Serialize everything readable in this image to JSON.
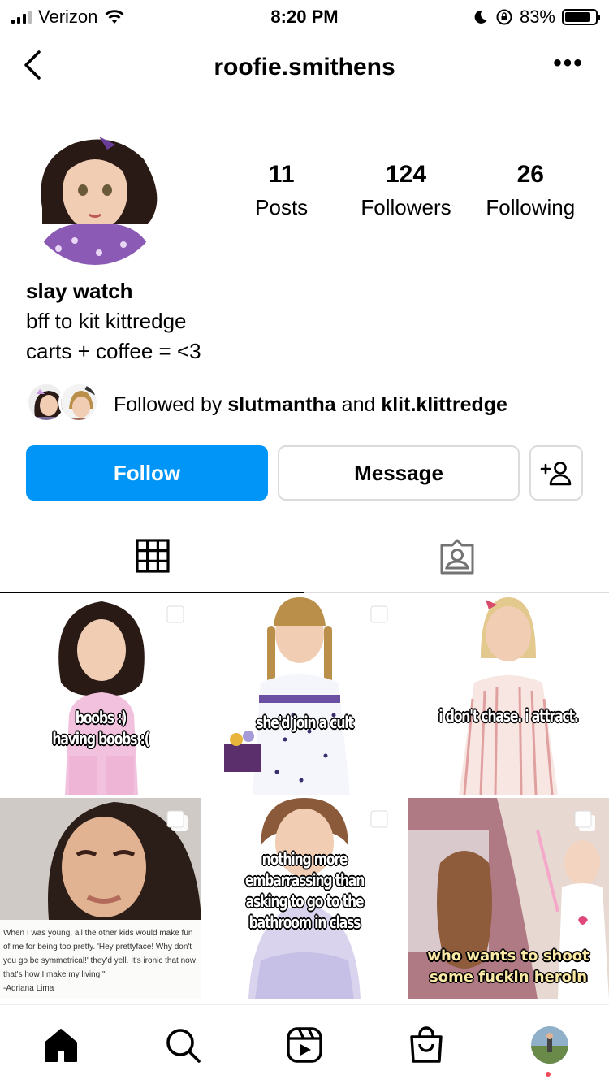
{
  "status_bar": {
    "carrier": "Verizon",
    "time": "8:20 PM",
    "battery": "83%",
    "battery_level": 0.83
  },
  "header": {
    "username": "roofie.smithens",
    "back_icon": "chevron-left-icon",
    "more_icon": "more-horizontal-icon",
    "more_label": "•••"
  },
  "profile": {
    "stats": [
      {
        "value": "11",
        "label": "Posts"
      },
      {
        "value": "124",
        "label": "Followers"
      },
      {
        "value": "26",
        "label": "Following"
      }
    ],
    "name": "slay watch",
    "bio_lines": [
      "bff to kit kittredge",
      "carts + coffee = <3"
    ],
    "followed_by": {
      "prefix": "Followed by ",
      "user1": "slutmantha",
      "joiner": " and ",
      "user2": "klit.klittredge"
    }
  },
  "actions": {
    "follow": "Follow",
    "message": "Message",
    "add_user_icon": "add-user-icon"
  },
  "colors": {
    "follow_button": "#0095f6",
    "notification_dot": "#ed4956"
  },
  "tabs": [
    {
      "icon": "grid-icon",
      "active": true
    },
    {
      "icon": "tagged-icon",
      "active": false
    }
  ],
  "posts": [
    {
      "caption": "boobs :)\nhaving boobs :("
    },
    {
      "caption": "she'd join a cult"
    },
    {
      "caption": "i don't chase. i attract."
    },
    {
      "caption": "",
      "quote": "When I was young, all the other kids would make fun of me for being too pretty. 'Hey prettyface! Why don't you go be symmetrical!' they'd yell. It's ironic that now that's how I make my living.\"\n-Adriana Lima"
    },
    {
      "caption": "nothing more\nembarrassing than\nasking to go to the\nbathroom in class"
    },
    {
      "caption": "who wants to shoot\nsome fuckin heroin"
    }
  ],
  "bottom_nav": [
    "home-icon",
    "search-icon",
    "reels-icon",
    "shop-icon",
    "profile-avatar"
  ]
}
